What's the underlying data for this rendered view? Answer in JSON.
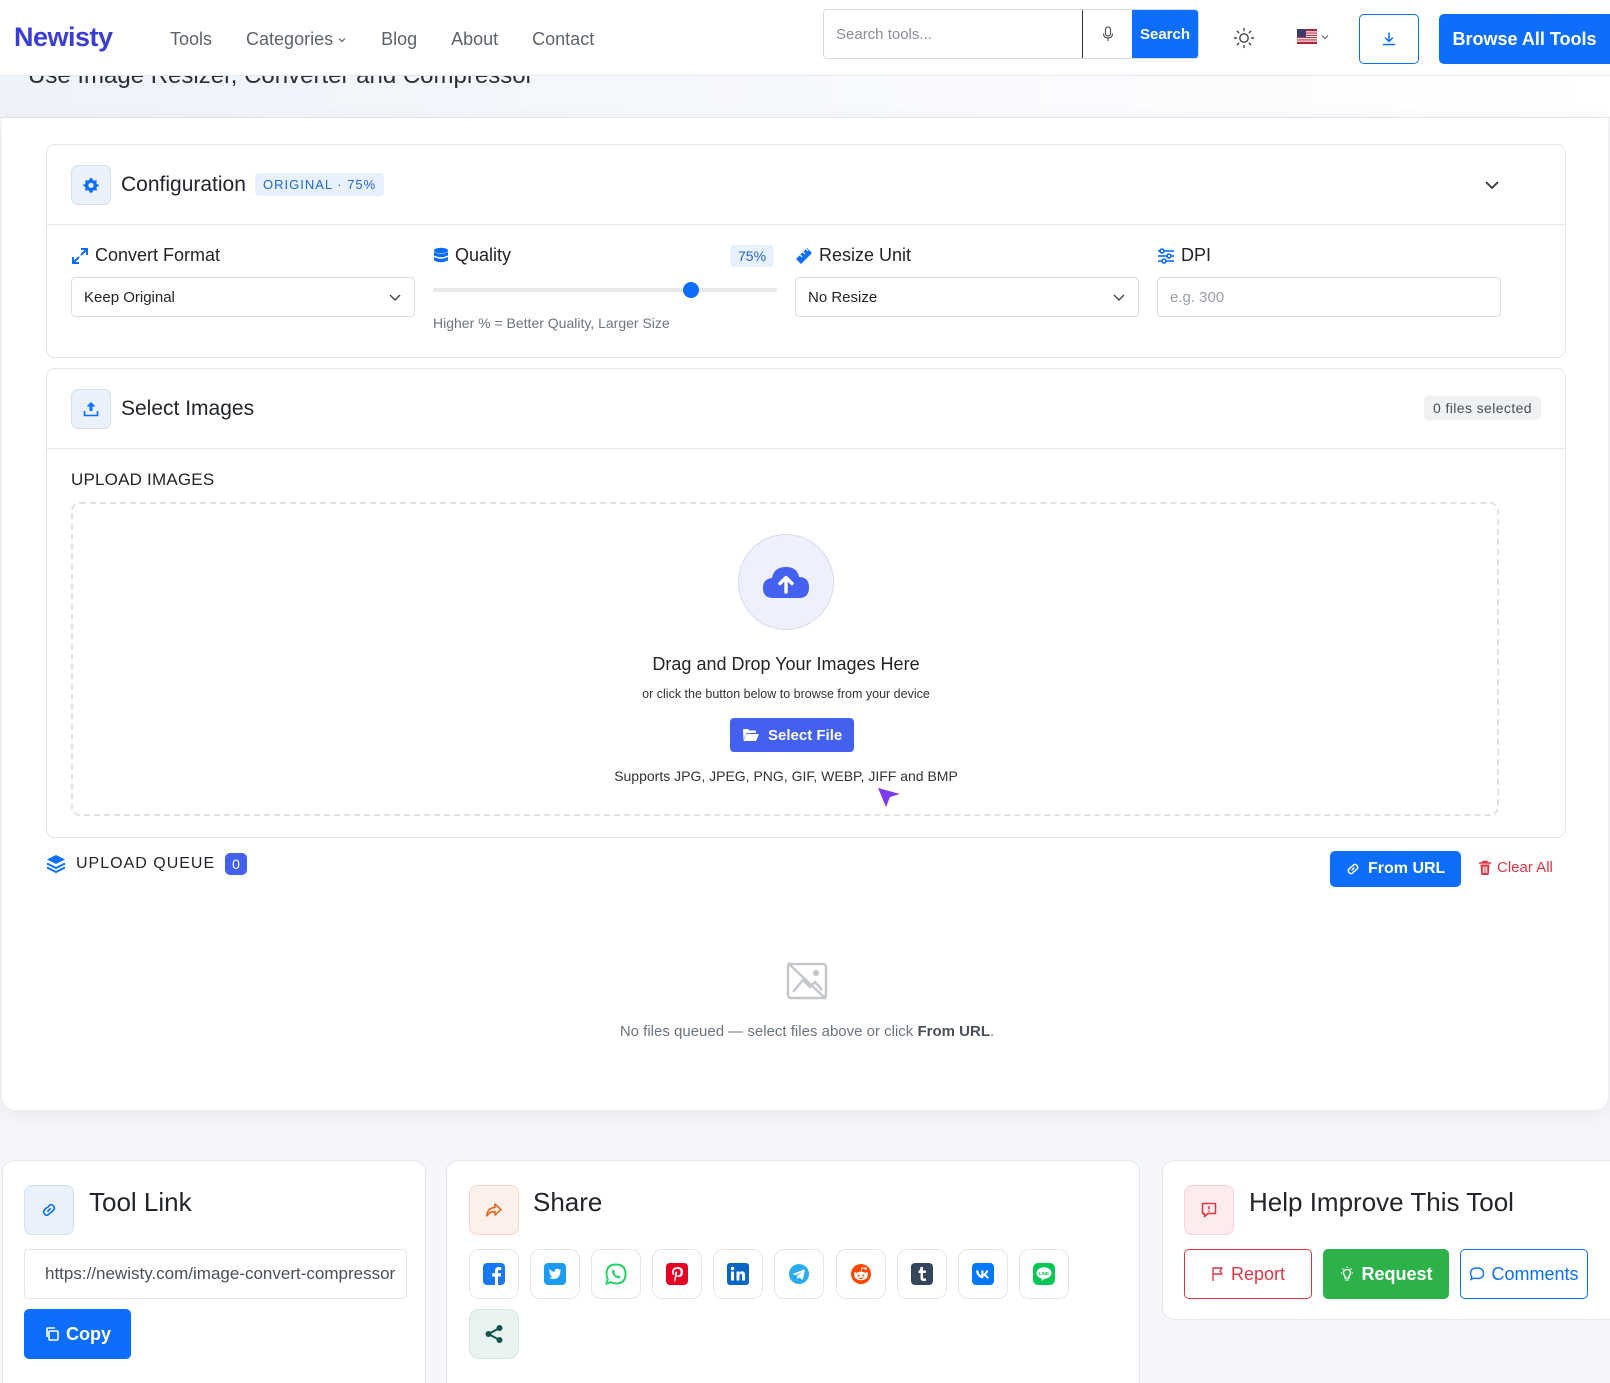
{
  "header": {
    "logo": "Newisty",
    "nav": [
      "Tools",
      "Categories",
      "Blog",
      "About",
      "Contact"
    ],
    "search_placeholder": "Search tools...",
    "search_button": "Search",
    "browse_button": "Browse All Tools"
  },
  "hero": {
    "text": "Use Image Resizer, Converter and Compressor"
  },
  "config": {
    "title": "Configuration",
    "badge": "ORIGINAL · 75%",
    "convert_label": "Convert Format",
    "convert_value": "Keep Original",
    "quality_label": "Quality",
    "quality_value": 75,
    "quality_badge": "75%",
    "quality_hint": "Higher % = Better Quality, Larger Size",
    "resize_label": "Resize Unit",
    "resize_value": "No Resize",
    "dpi_label": "DPI",
    "dpi_placeholder": "e.g. 300"
  },
  "select_images": {
    "title": "Select Images",
    "files_selected": "0 files selected",
    "upload_title": "UPLOAD IMAGES",
    "drop_title": "Drag and Drop Your Images Here",
    "drop_sub": "or click the button below to browse from your device",
    "select_button": "Select File",
    "supports": "Supports JPG, JPEG, PNG, GIF, WEBP, JIFF and BMP"
  },
  "queue": {
    "label": "UPLOAD QUEUE",
    "count": "0",
    "from_url": "From URL",
    "clear_all": "Clear All",
    "empty_prefix": "No files queued — select files above or click ",
    "empty_link": "From URL",
    "empty_suffix": "."
  },
  "tool_link": {
    "title": "Tool Link",
    "url": "https://newisty.com/image-convert-compressor",
    "copy": "Copy"
  },
  "share": {
    "title": "Share",
    "buttons": [
      "facebook-icon",
      "twitter-icon",
      "whatsapp-icon",
      "pinterest-icon",
      "linkedin-icon",
      "telegram-icon",
      "reddit-icon",
      "tumblr-icon",
      "vk-icon",
      "line-icon",
      "share-icon"
    ]
  },
  "help": {
    "title": "Help Improve This Tool",
    "report": "Report",
    "request": "Request",
    "comments": "Comments"
  },
  "colors": {
    "primary": "#0d6efd",
    "accent": "#4361ee",
    "danger": "#dc3545",
    "success": "#2db24a"
  }
}
